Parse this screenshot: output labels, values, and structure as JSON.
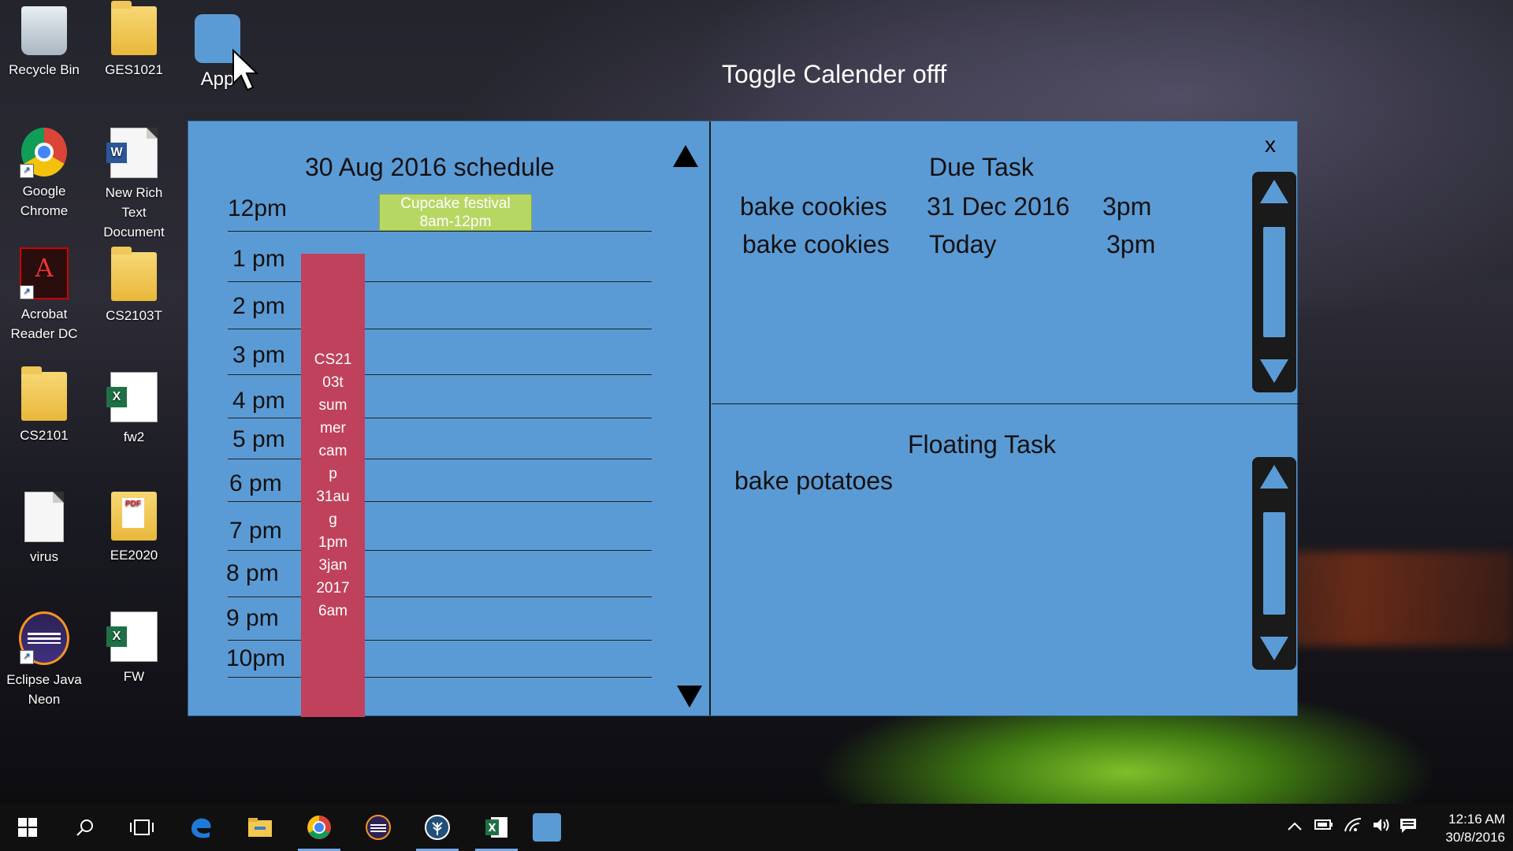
{
  "desktop": {
    "icons": [
      {
        "label_line1": "Recycle Bin",
        "label_line2": ""
      },
      {
        "label_line1": "GES1021",
        "label_line2": ""
      },
      {
        "label_line1": "App",
        "label_line2": ""
      },
      {
        "label_line1": "Google",
        "label_line2": "Chrome"
      },
      {
        "label_line1": "New Rich Text",
        "label_line2": "Document"
      },
      {
        "label_line1": "Acrobat",
        "label_line2": "Reader DC"
      },
      {
        "label_line1": "CS2103T",
        "label_line2": ""
      },
      {
        "label_line1": "CS2101",
        "label_line2": ""
      },
      {
        "label_line1": "fw2",
        "label_line2": ""
      },
      {
        "label_line1": "virus",
        "label_line2": ""
      },
      {
        "label_line1": "EE2020",
        "label_line2": ""
      },
      {
        "label_line1": "Eclipse Java",
        "label_line2": "Neon"
      },
      {
        "label_line1": "FW",
        "label_line2": ""
      }
    ]
  },
  "toggle_title": "Toggle Calender offf",
  "calendar": {
    "schedule_title": "30 Aug 2016 schedule",
    "hours": [
      "12pm",
      "1 pm",
      "2 pm",
      "3 pm",
      "4 pm",
      "5 pm",
      "6 pm",
      "7 pm",
      "8 pm",
      "9 pm",
      "10pm"
    ],
    "events": [
      {
        "line1": "Cupcake festival",
        "line2": "8am-12pm",
        "color": "#b7d763"
      },
      {
        "lines": [
          "CS21",
          "03t",
          "sum",
          "mer",
          "cam",
          "p",
          "31au",
          "g",
          "1pm",
          "3jan",
          "2017",
          "6am"
        ],
        "color": "#c0415b"
      }
    ]
  },
  "close_label": "x",
  "due_task": {
    "title": "Due Task",
    "rows": [
      {
        "name": "bake cookies",
        "date": "31 Dec 2016",
        "time": "3pm"
      },
      {
        "name": "bake cookies",
        "date": "Today",
        "time": "3pm"
      }
    ]
  },
  "floating_task": {
    "title": "Floating Task",
    "items": [
      "bake potatoes"
    ]
  },
  "taskbar": {
    "time": "12:16 AM",
    "date": "30/8/2016"
  },
  "colors": {
    "panel": "#5b9bd5",
    "event_green": "#b7d763",
    "event_red": "#c0415b",
    "taskbar": "#101010"
  }
}
